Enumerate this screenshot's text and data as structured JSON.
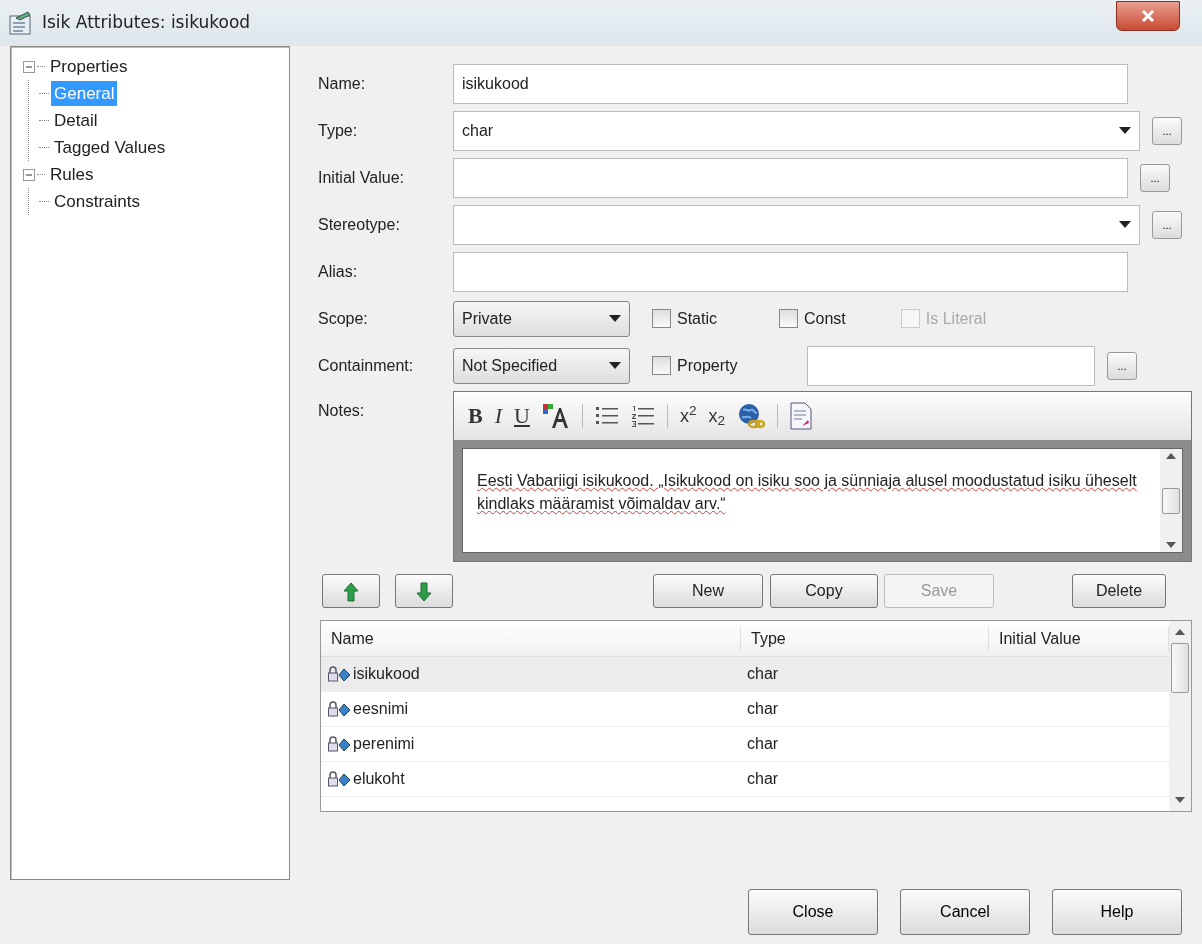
{
  "window": {
    "title": "Isik Attributes: isikukood"
  },
  "tree": [
    {
      "label": "Properties",
      "expanded": true,
      "selected": false,
      "children": [
        {
          "label": "General",
          "selected": true
        },
        {
          "label": "Detail",
          "selected": false
        },
        {
          "label": "Tagged Values",
          "selected": false
        }
      ]
    },
    {
      "label": "Rules",
      "expanded": true,
      "selected": false,
      "children": [
        {
          "label": "Constraints",
          "selected": false
        }
      ]
    }
  ],
  "fields": [
    {
      "label": "Name:",
      "kind": "text",
      "value": "isikukood"
    },
    {
      "label": "Type:",
      "kind": "combo",
      "value": "char",
      "ellipsis": "..."
    },
    {
      "label": "Initial Value:",
      "kind": "text",
      "ellipsis": "..."
    },
    {
      "label": "Stereotype:",
      "kind": "combo",
      "ellipsis": "..."
    },
    {
      "label": "Alias:",
      "kind": "text"
    }
  ],
  "scope": {
    "label": "Scope:",
    "value": "Private",
    "checkboxes": [
      {
        "label": "Static",
        "checked": false,
        "disabled": false
      },
      {
        "label": "Const",
        "checked": false,
        "disabled": false
      },
      {
        "label": "Is Literal",
        "checked": false,
        "disabled": true
      }
    ]
  },
  "containment": {
    "label": "Containment:",
    "value": "Not Specified",
    "checkbox": {
      "label": "Property",
      "checked": false,
      "disabled": false
    },
    "ellipsis": "..."
  },
  "notes": {
    "label": "Notes:",
    "toolbar": [
      {
        "kind": "bold",
        "text": "B"
      },
      {
        "kind": "italic",
        "text": "I"
      },
      {
        "kind": "underline",
        "text": "U"
      },
      {
        "kind": "font-color"
      },
      {
        "kind": "separator"
      },
      {
        "kind": "bullets"
      },
      {
        "kind": "numbering"
      },
      {
        "kind": "separator"
      },
      {
        "kind": "script",
        "text": "x$^{2}$"
      },
      {
        "kind": "script",
        "text": "x$_{2}$"
      },
      {
        "kind": "hyperlink"
      },
      {
        "kind": "separator"
      },
      {
        "kind": "document"
      }
    ],
    "text": "Eesti Vabariigi isikukood. „Isikukood on isiku soo ja sünniaja alusel moodustatud isiku üheselt kindlaks määramist võimaldav arv.“"
  },
  "actions": [
    {
      "label": "New",
      "disabled": false
    },
    {
      "label": "Copy",
      "disabled": false
    },
    {
      "label": "Save",
      "disabled": true
    },
    {
      "label": "Delete",
      "disabled": false
    }
  ],
  "table": {
    "columns": [
      "Name",
      "Type",
      "Initial Value"
    ],
    "rows": [
      {
        "name": "isikukood",
        "type": "char",
        "selected": true
      },
      {
        "name": "eesnimi",
        "type": "char",
        "selected": false
      },
      {
        "name": "perenimi",
        "type": "char",
        "selected": false
      },
      {
        "name": "elukoht",
        "type": "char",
        "selected": false
      }
    ]
  },
  "buttons": [
    "Close",
    "Cancel",
    "Help"
  ]
}
